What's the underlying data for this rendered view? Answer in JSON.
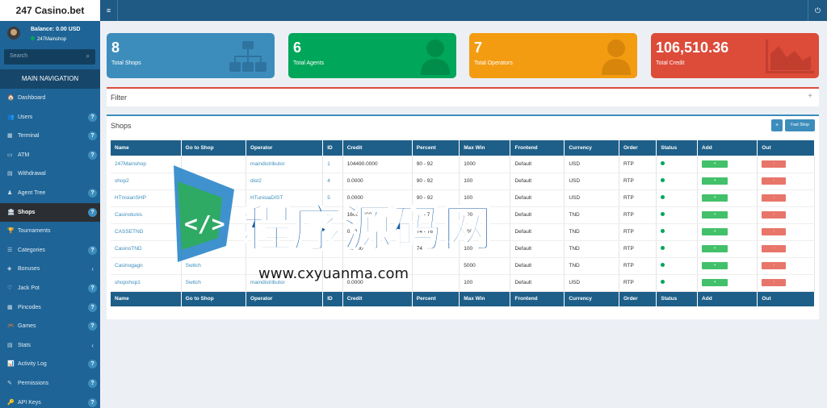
{
  "app": {
    "title": "247 Casino.bet"
  },
  "topbar": {
    "menu_icon": "≡",
    "power_icon": "⏻"
  },
  "user": {
    "balance": "Balance: 0.00 USD",
    "shop": "247Mainshop"
  },
  "search": {
    "placeholder": "Search"
  },
  "nav": {
    "header": "MAIN NAVIGATION",
    "items": [
      {
        "label": "Dashboard",
        "icon": "🏠",
        "badge": ""
      },
      {
        "label": "Users",
        "icon": "👥",
        "badge": "?"
      },
      {
        "label": "Terminal",
        "icon": "▦",
        "badge": "?"
      },
      {
        "label": "ATM",
        "icon": "▭",
        "badge": "?"
      },
      {
        "label": "Withdrawal",
        "icon": "▤",
        "badge": ""
      },
      {
        "label": "Agent Tree",
        "icon": "♟",
        "badge": "?"
      },
      {
        "label": "Shops",
        "icon": "🏛",
        "badge": "?"
      },
      {
        "label": "Tournaments",
        "icon": "🏆",
        "badge": ""
      },
      {
        "label": "Categories",
        "icon": "☰",
        "badge": "?"
      },
      {
        "label": "Bonuses",
        "icon": "◈",
        "badge": "‹"
      },
      {
        "label": "Jack Pot",
        "icon": "♡",
        "badge": "?"
      },
      {
        "label": "Pincodes",
        "icon": "▦",
        "badge": "?"
      },
      {
        "label": "Games",
        "icon": "🎮",
        "badge": "?"
      },
      {
        "label": "Stats",
        "icon": "▤",
        "badge": "‹"
      },
      {
        "label": "Activity Log",
        "icon": "📊",
        "badge": "?"
      },
      {
        "label": "Permissions",
        "icon": "✎",
        "badge": "?"
      },
      {
        "label": "API Keys",
        "icon": "🔑",
        "badge": "?"
      }
    ]
  },
  "stats": [
    {
      "value": "8",
      "label": "Total Shops"
    },
    {
      "value": "6",
      "label": "Total Agents"
    },
    {
      "value": "7",
      "label": "Total Operators"
    },
    {
      "value": "106,510.36",
      "label": "Total Credit"
    }
  ],
  "filter": {
    "title": "Filter",
    "toggle": "+"
  },
  "shops": {
    "title": "Shops",
    "add_button": "+",
    "fast_button": "Fast Shop",
    "columns": [
      "Name",
      "Go to Shop",
      "Operator",
      "ID",
      "Credit",
      "Percent",
      "Max Win",
      "Frontend",
      "Currency",
      "Order",
      "Status",
      "Add",
      "Out"
    ],
    "rows": [
      [
        "247Mainshop",
        "",
        "maindistributor",
        "1",
        "104490.0000",
        "90 - 92",
        "1000",
        "Default",
        "USD",
        "RTP"
      ],
      [
        "shop2",
        "",
        "dist2",
        "4",
        "0.0000",
        "90 - 92",
        "100",
        "Default",
        "USD",
        "RTP"
      ],
      [
        "HTnisianSHP",
        "",
        "HTunisiaDIST",
        "5",
        "0.0000",
        "90 - 92",
        "100",
        "Default",
        "USD",
        "RTP"
      ],
      [
        "Casinotunis",
        "",
        "",
        "6",
        "1600.3600",
        "74 - 76",
        "100",
        "Default",
        "TND",
        "RTP"
      ],
      [
        "CASSETND",
        "",
        "",
        "",
        "0.0000",
        "74 - 76",
        "100",
        "Default",
        "TND",
        "RTP"
      ],
      [
        "CasinoTND",
        "",
        "",
        "",
        "0.0000",
        "74 - 76",
        "100",
        "Default",
        "TND",
        "RTP"
      ],
      [
        "Casinogagn",
        "Switch",
        "",
        "",
        "",
        "",
        "5000",
        "Default",
        "TND",
        "RTP"
      ],
      [
        "shopshop1",
        "Switch",
        "maindistributor",
        "",
        "0.0000",
        "",
        "100",
        "Default",
        "USD",
        "RTP"
      ]
    ],
    "add_label": "+",
    "out_label": "-"
  },
  "watermark": {
    "text": "程序源码网",
    "url": "www.cxyuanma.com"
  },
  "colors": {
    "blue": "#3c8dbc",
    "green": "#00a65a",
    "orange": "#f39c12",
    "red": "#dd4b39",
    "header": "#1e5a84"
  }
}
